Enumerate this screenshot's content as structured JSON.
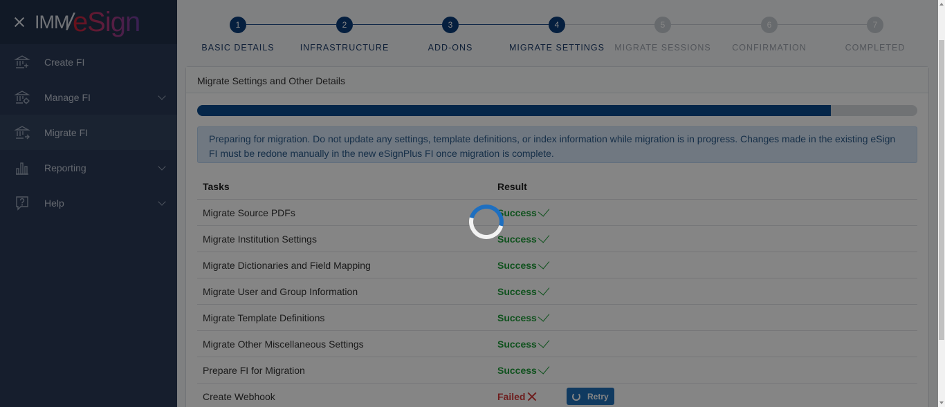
{
  "brand": {
    "imm": "IMM",
    "slash": "/",
    "esign": "eSign"
  },
  "sidebar": {
    "items": [
      {
        "label": "Create FI",
        "icon": "bank-plus-icon",
        "active": false,
        "expandable": false
      },
      {
        "label": "Manage FI",
        "icon": "bank-gear-icon",
        "active": false,
        "expandable": true
      },
      {
        "label": "Migrate FI",
        "icon": "bank-arrow-icon",
        "active": true,
        "expandable": false
      },
      {
        "label": "Reporting",
        "icon": "bar-chart-icon",
        "active": false,
        "expandable": true
      },
      {
        "label": "Help",
        "icon": "help-bubble-icon",
        "active": false,
        "expandable": true
      }
    ]
  },
  "stepper": {
    "steps": [
      {
        "num": "1",
        "label": "BASIC DETAILS",
        "done": true
      },
      {
        "num": "2",
        "label": "INFRASTRUCTURE",
        "done": true
      },
      {
        "num": "3",
        "label": "ADD-ONS",
        "done": true
      },
      {
        "num": "4",
        "label": "MIGRATE SETTINGS",
        "done": true
      },
      {
        "num": "5",
        "label": "MIGRATE SESSIONS",
        "done": false
      },
      {
        "num": "6",
        "label": "CONFIRMATION",
        "done": false
      },
      {
        "num": "7",
        "label": "COMPLETED",
        "done": false
      }
    ]
  },
  "card": {
    "title": "Migrate Settings and Other Details",
    "progress_percent": 88,
    "alert": "Preparing for migration. Do not update any settings, template definitions, or index information while migration is in progress. Changes made in the existing eSign FI must be redone manually in the new eSignPlus FI once migration is complete.",
    "columns": {
      "tasks": "Tasks",
      "result": "Result"
    },
    "rows": [
      {
        "task": "Migrate Source PDFs",
        "result": "Success",
        "status": "success"
      },
      {
        "task": "Migrate Institution Settings",
        "result": "Success",
        "status": "success"
      },
      {
        "task": "Migrate Dictionaries and Field Mapping",
        "result": "Success",
        "status": "success"
      },
      {
        "task": "Migrate User and Group Information",
        "result": "Success",
        "status": "success"
      },
      {
        "task": "Migrate Template Definitions",
        "result": "Success",
        "status": "success"
      },
      {
        "task": "Migrate Other Miscellaneous Settings",
        "result": "Success",
        "status": "success"
      },
      {
        "task": "Prepare FI for Migration",
        "result": "Success",
        "status": "success"
      },
      {
        "task": "Create Webhook",
        "result": "Failed",
        "status": "failed",
        "action": "Retry"
      }
    ]
  },
  "colors": {
    "accent": "#0a3c7a",
    "success": "#1f9d3a",
    "failed": "#d33b3b",
    "sidebar": "#2b3a57"
  }
}
